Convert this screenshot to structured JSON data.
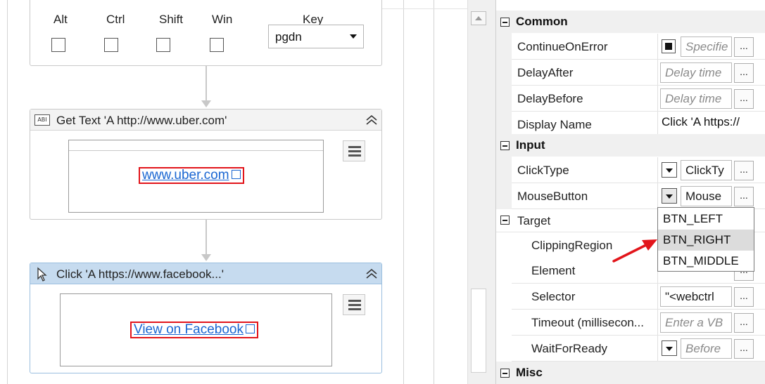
{
  "designer": {
    "send_hotkey": {
      "modifiers": [
        {
          "label": "Alt",
          "checked": false
        },
        {
          "label": "Ctrl",
          "checked": false
        },
        {
          "label": "Shift",
          "checked": false
        },
        {
          "label": "Win",
          "checked": false
        }
      ],
      "key_label": "Key",
      "key_value": "pgdn"
    },
    "get_text": {
      "title": "Get Text 'A  http://www.uber.com'",
      "icon": "text-field-icon",
      "icon_text": "ABI",
      "preview_link": "www.uber.com"
    },
    "click": {
      "title": "Click 'A  https://www.facebook...'",
      "icon": "cursor-icon",
      "preview_link": "View on Facebook"
    }
  },
  "properties": {
    "categories": {
      "common": "Common",
      "input": "Input",
      "target": "Target",
      "misc": "Misc"
    },
    "rows": {
      "continue_on_error": {
        "name": "ContinueOnError",
        "value": "Specifie",
        "checked": true
      },
      "delay_after": {
        "name": "DelayAfter",
        "placeholder": "Delay time"
      },
      "delay_before": {
        "name": "DelayBefore",
        "placeholder": "Delay time"
      },
      "display_name": {
        "name": "Display Name",
        "value": "Click 'A  https://"
      },
      "click_type": {
        "name": "ClickType",
        "value": "ClickTy"
      },
      "mouse_button": {
        "name": "MouseButton",
        "value": "Mouse"
      },
      "clipping_region": {
        "name": "ClippingRegion"
      },
      "element": {
        "name": "Element"
      },
      "selector": {
        "name": "Selector",
        "value": "\"<webctrl"
      },
      "timeout": {
        "name": "Timeout (millisecon...",
        "placeholder": "Enter a VB"
      },
      "wait_for_ready": {
        "name": "WaitForReady",
        "placeholder": "Before"
      }
    },
    "ellipsis": "...",
    "mouse_button_options": [
      "BTN_LEFT",
      "BTN_RIGHT",
      "BTN_MIDDLE"
    ],
    "highlighted_option": "BTN_RIGHT"
  },
  "colors": {
    "selected_header": "#c6dbef",
    "link": "#1a66d2",
    "highlight_border": "#e2151b",
    "annotation_arrow": "#e2151b"
  }
}
